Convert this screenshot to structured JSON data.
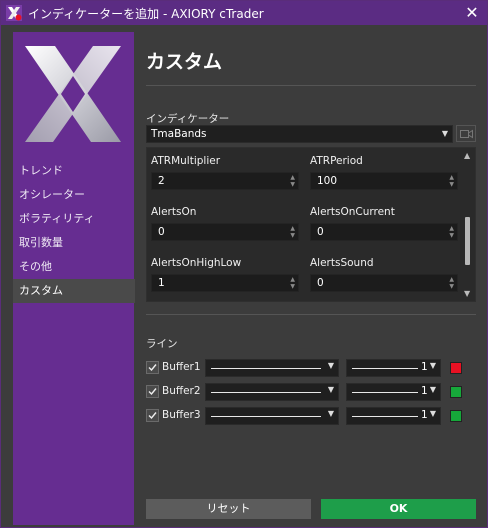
{
  "window": {
    "title": "インディケーターを追加 - AXIORY cTrader",
    "close_symbol": "✕"
  },
  "sidebar": {
    "items": [
      {
        "label": "トレンド"
      },
      {
        "label": "オシレーター"
      },
      {
        "label": "ボラティリティ"
      },
      {
        "label": "取引数量"
      },
      {
        "label": "その他"
      },
      {
        "label": "カスタム",
        "active": true
      }
    ]
  },
  "main": {
    "heading": "カスタム",
    "indicator_label": "インディケーター",
    "indicator_value": "TmaBands",
    "params": [
      {
        "label": "ATRMultiplier",
        "value": "2"
      },
      {
        "label": "ATRPeriod",
        "value": "100"
      },
      {
        "label": "AlertsOn",
        "value": "0"
      },
      {
        "label": "AlertsOnCurrent",
        "value": "0"
      },
      {
        "label": "AlertsOnHighLow",
        "value": "1"
      },
      {
        "label": "AlertsSound",
        "value": "0"
      }
    ],
    "lines_label": "ライン",
    "lines": [
      {
        "name": "Buffer1",
        "checked": true,
        "width": "1",
        "color": "#e81123"
      },
      {
        "name": "Buffer2",
        "checked": true,
        "width": "1",
        "color": "#16a83a"
      },
      {
        "name": "Buffer3",
        "checked": true,
        "width": "1",
        "color": "#16a83a"
      }
    ]
  },
  "buttons": {
    "reset": "リセット",
    "ok": "OK"
  },
  "colors": {
    "title_bar": "#5b2c83",
    "sidebar": "#662d91",
    "ok_button": "#1e9e4a"
  }
}
